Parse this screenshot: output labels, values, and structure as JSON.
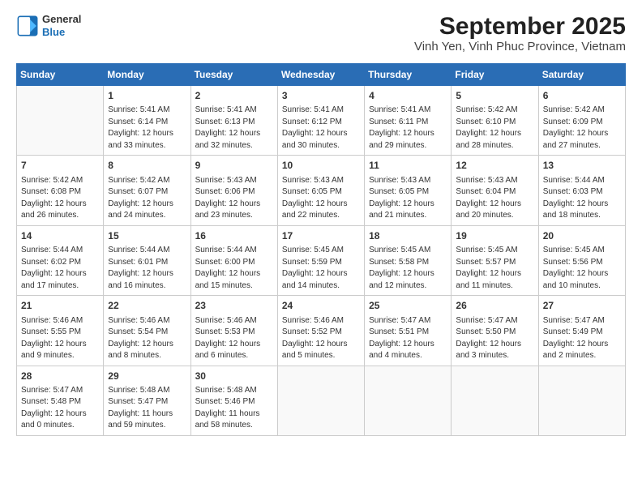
{
  "header": {
    "logo_line1": "General",
    "logo_line2": "Blue",
    "title": "September 2025",
    "subtitle": "Vinh Yen, Vinh Phuc Province, Vietnam"
  },
  "days_of_week": [
    "Sunday",
    "Monday",
    "Tuesday",
    "Wednesday",
    "Thursday",
    "Friday",
    "Saturday"
  ],
  "weeks": [
    [
      {
        "day": "",
        "info": ""
      },
      {
        "day": "1",
        "info": "Sunrise: 5:41 AM\nSunset: 6:14 PM\nDaylight: 12 hours\nand 33 minutes."
      },
      {
        "day": "2",
        "info": "Sunrise: 5:41 AM\nSunset: 6:13 PM\nDaylight: 12 hours\nand 32 minutes."
      },
      {
        "day": "3",
        "info": "Sunrise: 5:41 AM\nSunset: 6:12 PM\nDaylight: 12 hours\nand 30 minutes."
      },
      {
        "day": "4",
        "info": "Sunrise: 5:41 AM\nSunset: 6:11 PM\nDaylight: 12 hours\nand 29 minutes."
      },
      {
        "day": "5",
        "info": "Sunrise: 5:42 AM\nSunset: 6:10 PM\nDaylight: 12 hours\nand 28 minutes."
      },
      {
        "day": "6",
        "info": "Sunrise: 5:42 AM\nSunset: 6:09 PM\nDaylight: 12 hours\nand 27 minutes."
      }
    ],
    [
      {
        "day": "7",
        "info": "Sunrise: 5:42 AM\nSunset: 6:08 PM\nDaylight: 12 hours\nand 26 minutes."
      },
      {
        "day": "8",
        "info": "Sunrise: 5:42 AM\nSunset: 6:07 PM\nDaylight: 12 hours\nand 24 minutes."
      },
      {
        "day": "9",
        "info": "Sunrise: 5:43 AM\nSunset: 6:06 PM\nDaylight: 12 hours\nand 23 minutes."
      },
      {
        "day": "10",
        "info": "Sunrise: 5:43 AM\nSunset: 6:05 PM\nDaylight: 12 hours\nand 22 minutes."
      },
      {
        "day": "11",
        "info": "Sunrise: 5:43 AM\nSunset: 6:05 PM\nDaylight: 12 hours\nand 21 minutes."
      },
      {
        "day": "12",
        "info": "Sunrise: 5:43 AM\nSunset: 6:04 PM\nDaylight: 12 hours\nand 20 minutes."
      },
      {
        "day": "13",
        "info": "Sunrise: 5:44 AM\nSunset: 6:03 PM\nDaylight: 12 hours\nand 18 minutes."
      }
    ],
    [
      {
        "day": "14",
        "info": "Sunrise: 5:44 AM\nSunset: 6:02 PM\nDaylight: 12 hours\nand 17 minutes."
      },
      {
        "day": "15",
        "info": "Sunrise: 5:44 AM\nSunset: 6:01 PM\nDaylight: 12 hours\nand 16 minutes."
      },
      {
        "day": "16",
        "info": "Sunrise: 5:44 AM\nSunset: 6:00 PM\nDaylight: 12 hours\nand 15 minutes."
      },
      {
        "day": "17",
        "info": "Sunrise: 5:45 AM\nSunset: 5:59 PM\nDaylight: 12 hours\nand 14 minutes."
      },
      {
        "day": "18",
        "info": "Sunrise: 5:45 AM\nSunset: 5:58 PM\nDaylight: 12 hours\nand 12 minutes."
      },
      {
        "day": "19",
        "info": "Sunrise: 5:45 AM\nSunset: 5:57 PM\nDaylight: 12 hours\nand 11 minutes."
      },
      {
        "day": "20",
        "info": "Sunrise: 5:45 AM\nSunset: 5:56 PM\nDaylight: 12 hours\nand 10 minutes."
      }
    ],
    [
      {
        "day": "21",
        "info": "Sunrise: 5:46 AM\nSunset: 5:55 PM\nDaylight: 12 hours\nand 9 minutes."
      },
      {
        "day": "22",
        "info": "Sunrise: 5:46 AM\nSunset: 5:54 PM\nDaylight: 12 hours\nand 8 minutes."
      },
      {
        "day": "23",
        "info": "Sunrise: 5:46 AM\nSunset: 5:53 PM\nDaylight: 12 hours\nand 6 minutes."
      },
      {
        "day": "24",
        "info": "Sunrise: 5:46 AM\nSunset: 5:52 PM\nDaylight: 12 hours\nand 5 minutes."
      },
      {
        "day": "25",
        "info": "Sunrise: 5:47 AM\nSunset: 5:51 PM\nDaylight: 12 hours\nand 4 minutes."
      },
      {
        "day": "26",
        "info": "Sunrise: 5:47 AM\nSunset: 5:50 PM\nDaylight: 12 hours\nand 3 minutes."
      },
      {
        "day": "27",
        "info": "Sunrise: 5:47 AM\nSunset: 5:49 PM\nDaylight: 12 hours\nand 2 minutes."
      }
    ],
    [
      {
        "day": "28",
        "info": "Sunrise: 5:47 AM\nSunset: 5:48 PM\nDaylight: 12 hours\nand 0 minutes."
      },
      {
        "day": "29",
        "info": "Sunrise: 5:48 AM\nSunset: 5:47 PM\nDaylight: 11 hours\nand 59 minutes."
      },
      {
        "day": "30",
        "info": "Sunrise: 5:48 AM\nSunset: 5:46 PM\nDaylight: 11 hours\nand 58 minutes."
      },
      {
        "day": "",
        "info": ""
      },
      {
        "day": "",
        "info": ""
      },
      {
        "day": "",
        "info": ""
      },
      {
        "day": "",
        "info": ""
      }
    ]
  ]
}
